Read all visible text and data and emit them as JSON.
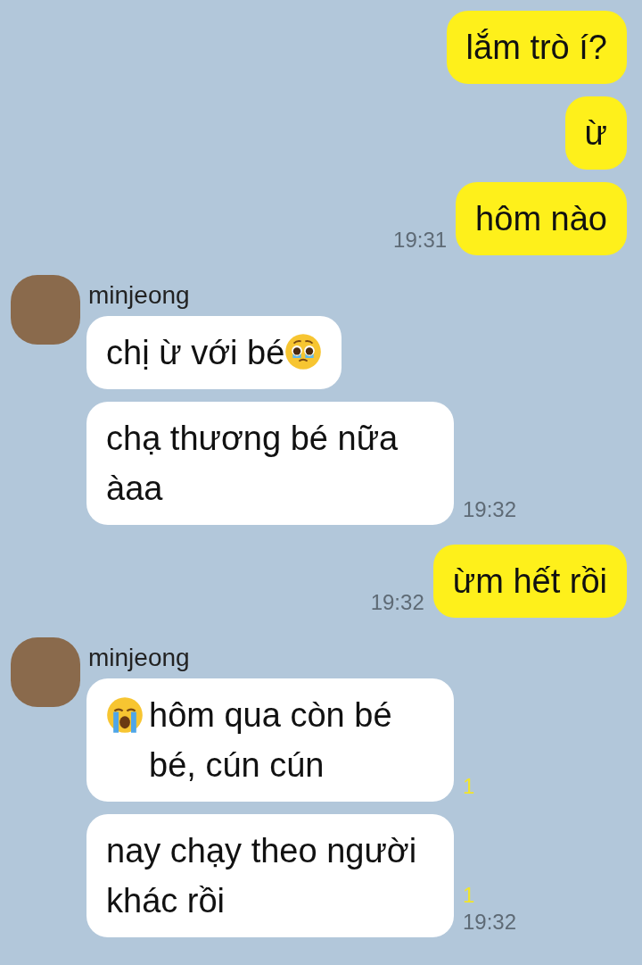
{
  "groups": [
    {
      "kind": "outgoing",
      "messages": [
        {
          "kind": "text",
          "text": "lắm trò í?"
        },
        {
          "kind": "text",
          "text": "ừ"
        },
        {
          "kind": "text",
          "text": "hôm nào",
          "time": "19:31"
        }
      ]
    },
    {
      "kind": "incoming",
      "name": "minjeong",
      "messages": [
        {
          "kind": "trailing-icon",
          "text": "chị ừ với bé"
        },
        {
          "kind": "text",
          "text": "chạ thương bé nữa àaa",
          "time": "19:32"
        }
      ]
    },
    {
      "kind": "outgoing",
      "messages": [
        {
          "kind": "text",
          "text": "ừm hết rồi",
          "time": "19:32"
        }
      ]
    },
    {
      "kind": "incoming",
      "name": "minjeong",
      "messages": [
        {
          "kind": "leading-icon",
          "text": "hôm qua còn bé bé, cún cún",
          "unread": "1"
        },
        {
          "kind": "text",
          "text": "nay chạy theo người khác rồi",
          "unread": "1",
          "time": "19:32"
        }
      ]
    }
  ]
}
